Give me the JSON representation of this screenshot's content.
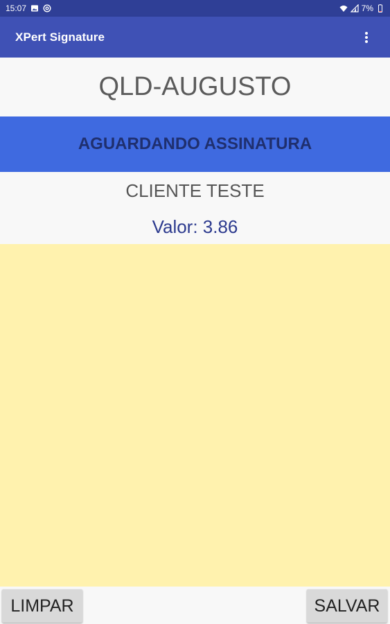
{
  "status_bar": {
    "time": "15:07",
    "battery": "7%",
    "icons": [
      "image-icon",
      "at-sign-icon",
      "wifi-icon",
      "signal-icon",
      "battery-icon"
    ]
  },
  "app_bar": {
    "title": "XPert Signature",
    "menu_icon": "overflow-menu-icon",
    "color": "#3f51b5"
  },
  "plate": "QLD-AUGUSTO",
  "banner": {
    "text": "AGUARDANDO ASSINATURA",
    "background": "#3f6ae0"
  },
  "client": {
    "name": "CLIENTE TESTE",
    "value": "Valor: 3.86"
  },
  "signature_pad": {
    "background": "#fff2ae"
  },
  "actions": {
    "clear_label": "LIMPAR",
    "save_label": "SALVAR"
  }
}
